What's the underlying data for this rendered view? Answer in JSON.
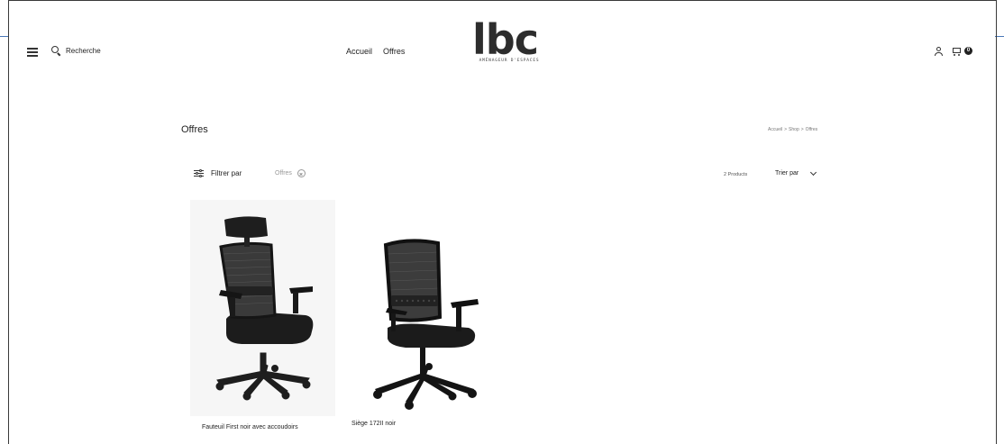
{
  "header": {
    "search_label": "Recherche",
    "nav": [
      "Accueil",
      "Offres"
    ],
    "logo_text": "lbc",
    "logo_subtitle": "AMÉNAGEUR D'ESPACES",
    "cart_count": "0"
  },
  "page": {
    "title": "Offres",
    "breadcrumb": [
      "Accueil",
      ">",
      "Shop",
      ">",
      "Offres"
    ]
  },
  "filters": {
    "toggle_label": "Filtrer par",
    "active_filter": "Offres"
  },
  "listing": {
    "product_count": "2 Products",
    "sort_label": "Trier par"
  },
  "products": [
    {
      "name": "Fauteuil First noir avec accoudoirs"
    },
    {
      "name": "Siège 172II noir"
    }
  ],
  "icons": [
    "menu-icon",
    "search-icon",
    "account-icon",
    "cart-icon",
    "filter-icon",
    "remove-icon",
    "chevron-down-icon"
  ],
  "colors": {
    "text": "#222222",
    "muted": "#999999",
    "chair": "#1e1e1e"
  }
}
